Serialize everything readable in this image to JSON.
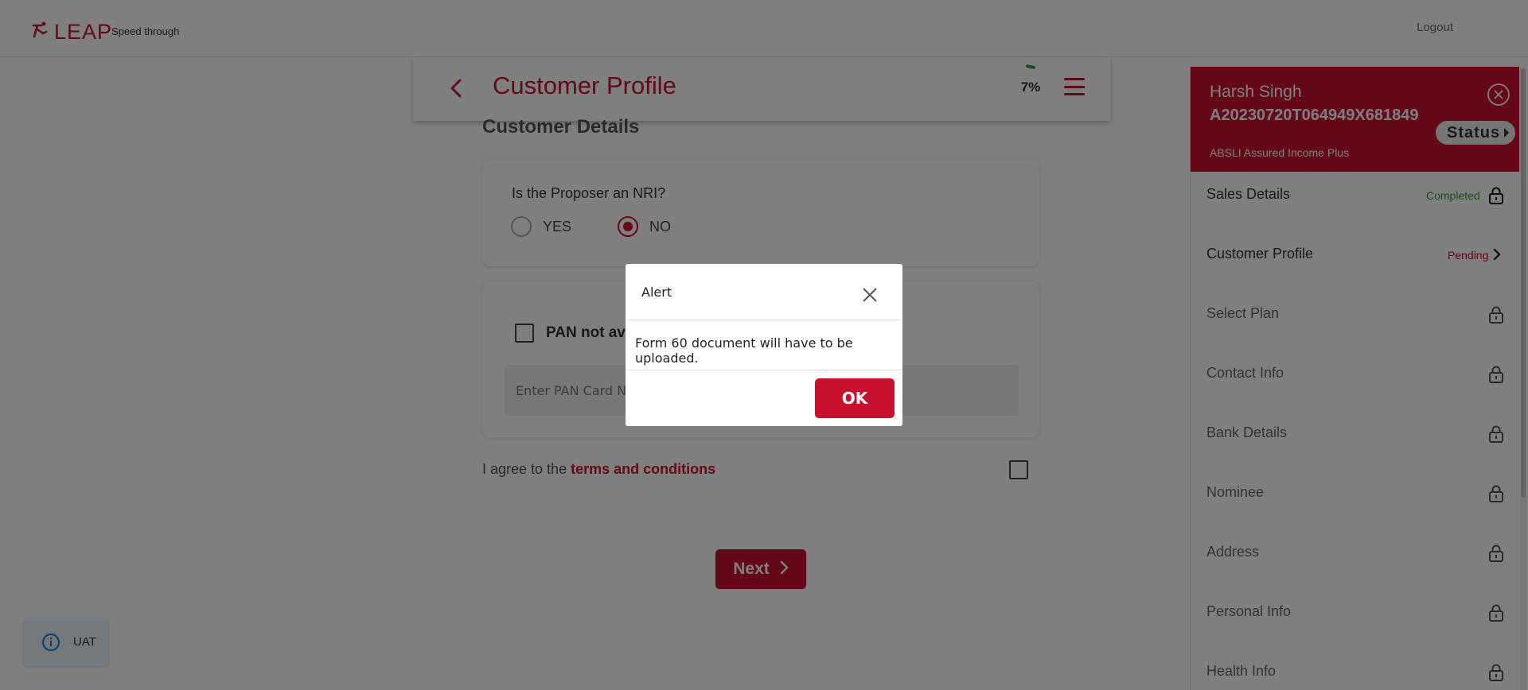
{
  "app": {
    "brand": "LEAP",
    "tagline": "Speed through",
    "logout_label": "Logout"
  },
  "header": {
    "title": "Customer Profile",
    "progress": "7%",
    "progress_value": 0.07
  },
  "main": {
    "section_title": "Customer Details",
    "nri_question": "Is the Proposer an NRI?",
    "nri_options": [
      {
        "label": "YES",
        "selected": false
      },
      {
        "label": "NO",
        "selected": true
      }
    ],
    "pan_checkbox_label": "PAN not available",
    "pan_checkbox_checked": false,
    "pan_placeholder": "Enter PAN Card Number",
    "terms_prefix": "I agree to the ",
    "terms_link": "terms and conditions",
    "terms_checked": false,
    "next_label": "Next"
  },
  "sidebar": {
    "name": "Harsh Singh",
    "application_id": "A20230720T064949X681849",
    "plan": "ABSLI Assured Income Plus",
    "status_label": "Status",
    "items": [
      {
        "label": "Sales Details",
        "state": "Completed"
      },
      {
        "label": "Customer Profile",
        "state": "Pending"
      },
      {
        "label": "Select Plan",
        "state": ""
      },
      {
        "label": "Contact Info",
        "state": ""
      },
      {
        "label": "Bank Details",
        "state": ""
      },
      {
        "label": "Nominee",
        "state": ""
      },
      {
        "label": "Address",
        "state": ""
      },
      {
        "label": "Personal Info",
        "state": ""
      },
      {
        "label": "Health Info",
        "state": ""
      }
    ]
  },
  "env_badge": "UAT",
  "modal": {
    "title": "Alert",
    "message": "Form 60 document will have to be uploaded.",
    "ok_label": "OK"
  },
  "colors": {
    "brand_red": "#c8102e",
    "success_green": "#2e9e4a",
    "overlay": "rgba(0,0,0,0.5)"
  },
  "icons": [
    "leap-logo-icon",
    "back-arrow-icon",
    "menu-icon",
    "close-circle-icon",
    "status-caret-icon",
    "lock-icon",
    "chevron-right-icon",
    "info-icon",
    "close-icon"
  ]
}
